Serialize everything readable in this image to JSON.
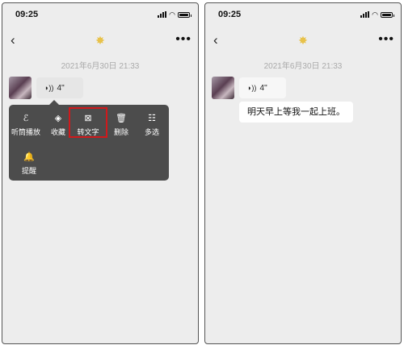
{
  "status_bar": {
    "time": "09:25"
  },
  "chat": {
    "timestamp": "2021年6月30日 21:33",
    "voice_message": {
      "duration": "4''"
    },
    "transcribed_text": "明天早上等我一起上班。"
  },
  "context_menu": {
    "items": [
      {
        "label": "听筒播放",
        "icon": "ear-icon",
        "glyph": "ℰ"
      },
      {
        "label": "收藏",
        "icon": "cube-icon",
        "glyph": "◈"
      },
      {
        "label": "转文字",
        "icon": "transcribe-icon",
        "glyph": "⊠"
      },
      {
        "label": "删除",
        "icon": "trash-icon",
        "glyph": "🗑"
      },
      {
        "label": "多选",
        "icon": "multiselect-icon",
        "glyph": "☷"
      },
      {
        "label": "提醒",
        "icon": "bell-icon",
        "glyph": "🔔"
      }
    ],
    "highlighted_item": "转文字",
    "highlight_color": "#d0191c"
  },
  "colors": {
    "chat_background": "#ededed",
    "menu_background": "#4c4c4c"
  }
}
